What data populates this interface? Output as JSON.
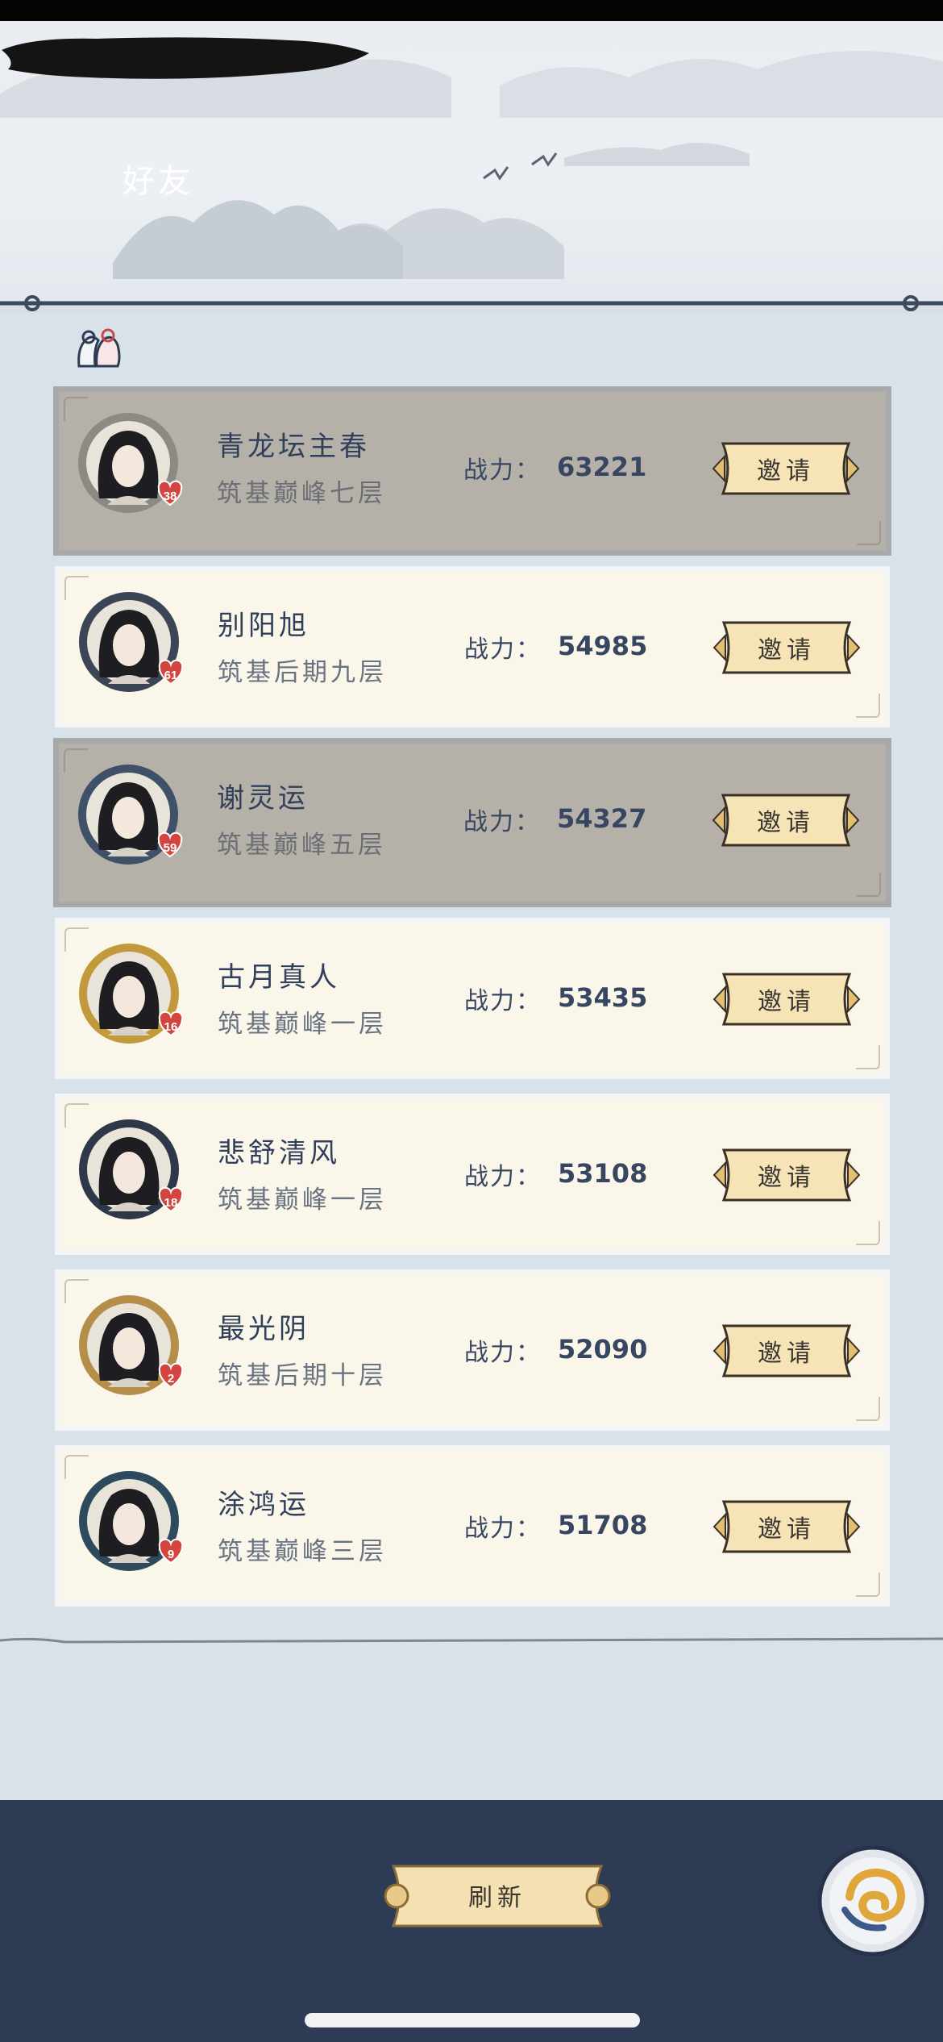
{
  "header": {
    "title": "好友"
  },
  "friends_section": {
    "icon": "friends-icon"
  },
  "power_label": "战力：",
  "friends": [
    {
      "name": "青龙坛主春",
      "realm": "筑基巅峰七层",
      "power": "63221",
      "level": "38",
      "invite_label": "邀请",
      "online": false
    },
    {
      "name": "别阳旭",
      "realm": "筑基后期九层",
      "power": "54985",
      "level": "61",
      "invite_label": "邀请",
      "online": true
    },
    {
      "name": "谢灵运",
      "realm": "筑基巅峰五层",
      "power": "54327",
      "level": "59",
      "invite_label": "邀请",
      "online": false
    },
    {
      "name": "古月真人",
      "realm": "筑基巅峰一层",
      "power": "53435",
      "level": "16",
      "invite_label": "邀请",
      "online": true
    },
    {
      "name": "悲舒清风",
      "realm": "筑基巅峰一层",
      "power": "53108",
      "level": "18",
      "invite_label": "邀请",
      "online": true
    },
    {
      "name": "最光阴",
      "realm": "筑基后期十层",
      "power": "52090",
      "level": "2",
      "invite_label": "邀请",
      "online": true
    },
    {
      "name": "涂鸿运",
      "realm": "筑基巅峰三层",
      "power": "51708",
      "level": "9",
      "invite_label": "邀请",
      "online": true
    }
  ],
  "footer": {
    "refresh_label": "刷新",
    "back_icon": "back-swirl-icon"
  },
  "colors": {
    "footer_bg": "#2d3b55",
    "button_gold": "#f3dca6",
    "name_text": "#30405a",
    "offline_row": "#b5b1a8"
  }
}
